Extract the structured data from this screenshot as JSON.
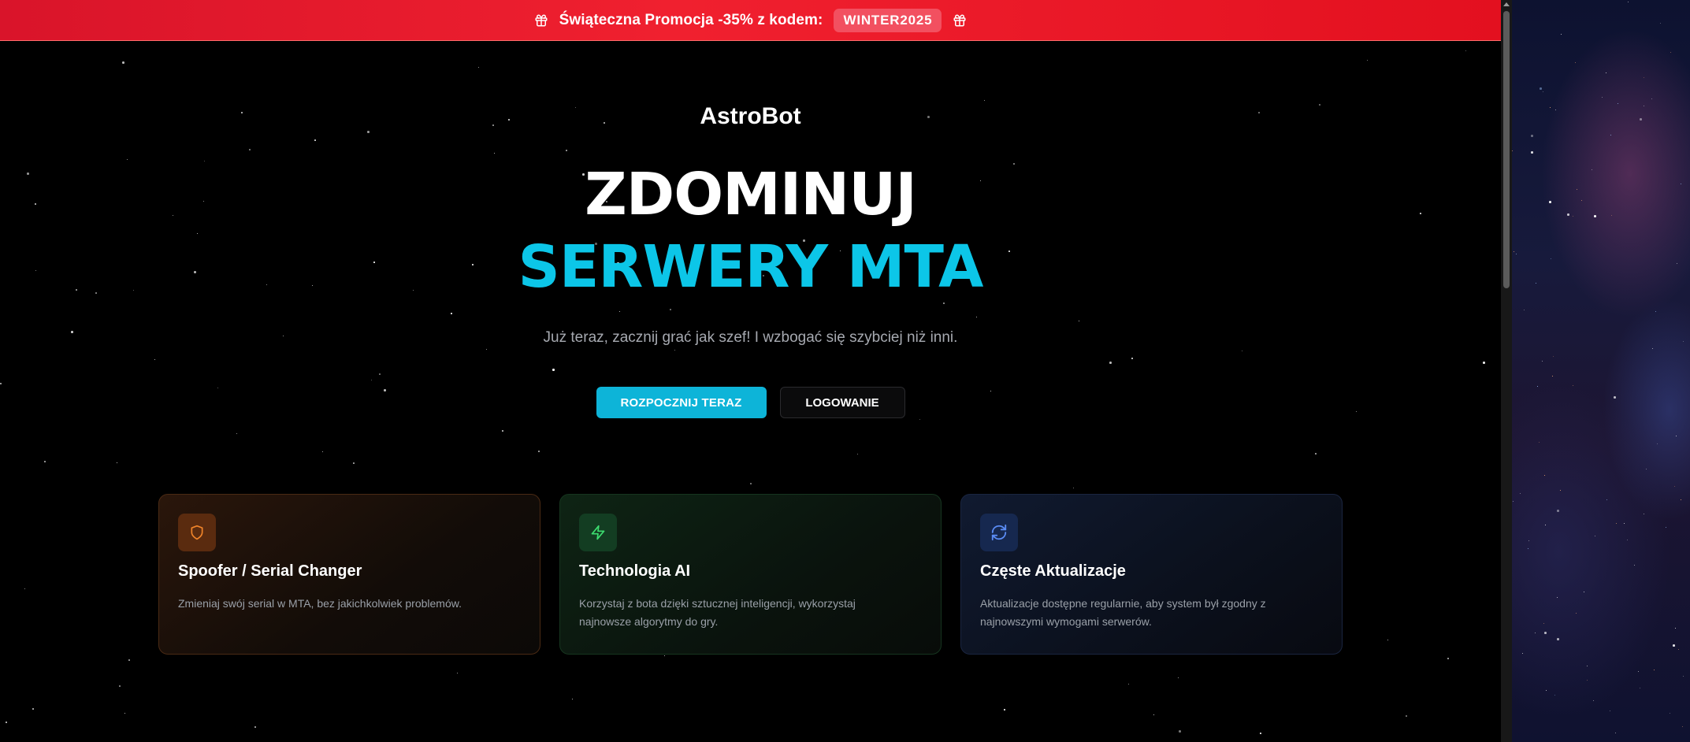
{
  "promo": {
    "text": "Świąteczna Promocja -35% z kodem:",
    "code": "WINTER2025"
  },
  "hero": {
    "brand": "AstroBot",
    "headline_line1": "ZDOMINUJ",
    "headline_line2": "SERWERY MTA",
    "tagline": "Już teraz, zacznij grać jak szef! I wzbogać się szybciej niż inni."
  },
  "cta": {
    "primary_label": "ROZPOCZNIJ TERAZ",
    "secondary_label": "LOGOWANIE"
  },
  "features": [
    {
      "icon": "shield-icon",
      "title": "Spoofer / Serial Changer",
      "description": "Zmieniaj swój serial w MTA, bez jakichkolwiek problemów."
    },
    {
      "icon": "lightning-icon",
      "title": "Technologia AI",
      "description": "Korzystaj z bota dzięki sztucznej inteligencji, wykorzystaj najnowsze algorytmy do gry."
    },
    {
      "icon": "refresh-icon",
      "title": "Częste Aktualizacje",
      "description": "Aktualizacje dostępne regularnie, aby system był zgodny z najnowszymi wymogami serwerów."
    }
  ],
  "colors": {
    "accent": "#0cc6e8",
    "promo_red": "#ee1c2e",
    "orange_icon": "#f0842a",
    "green_icon": "#3ddc6f",
    "blue_icon": "#5b8df6"
  }
}
